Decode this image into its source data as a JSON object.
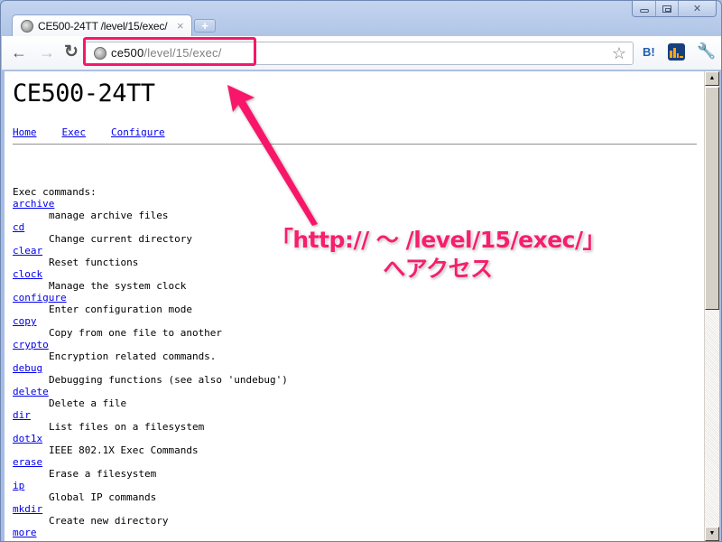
{
  "browser": {
    "tab_title": "CE500-24TT /level/15/exec/",
    "tab_close": "×",
    "new_tab": "+",
    "url_host": "ce500",
    "url_path": "/level/15/exec/",
    "back_icon": "←",
    "forward_icon": "→",
    "reload_icon": "↻",
    "star_icon": "☆",
    "ext_hatena": "B!",
    "wrench_icon": "🔧",
    "window_close": "✕"
  },
  "page": {
    "title": "CE500-24TT",
    "nav": [
      {
        "label": "Home"
      },
      {
        "label": "Exec"
      },
      {
        "label": "Configure"
      }
    ],
    "section_label": "Exec commands:",
    "commands": [
      {
        "name": "archive",
        "desc": "manage archive files"
      },
      {
        "name": "cd",
        "desc": "Change current directory"
      },
      {
        "name": "clear",
        "desc": "Reset functions"
      },
      {
        "name": "clock",
        "desc": "Manage the system clock"
      },
      {
        "name": "configure",
        "desc": "Enter configuration mode"
      },
      {
        "name": "copy",
        "desc": "Copy from one file to another"
      },
      {
        "name": "crypto",
        "desc": "Encryption related commands."
      },
      {
        "name": "debug",
        "desc": "Debugging functions (see also 'undebug')"
      },
      {
        "name": "delete",
        "desc": "Delete a file"
      },
      {
        "name": "dir",
        "desc": "List files on a filesystem"
      },
      {
        "name": "dot1x",
        "desc": "IEEE 802.1X Exec Commands"
      },
      {
        "name": "erase",
        "desc": "Erase a filesystem"
      },
      {
        "name": "ip",
        "desc": "Global IP commands"
      },
      {
        "name": "mkdir",
        "desc": "Create new directory"
      },
      {
        "name": "more",
        "desc": ""
      }
    ]
  },
  "annotation": {
    "line1": "「http:// 〜 /level/15/exec/」",
    "line2": "へアクセス",
    "color": "#f51f6d"
  },
  "scrollbar": {
    "up_icon": "▲",
    "down_icon": "▼"
  }
}
